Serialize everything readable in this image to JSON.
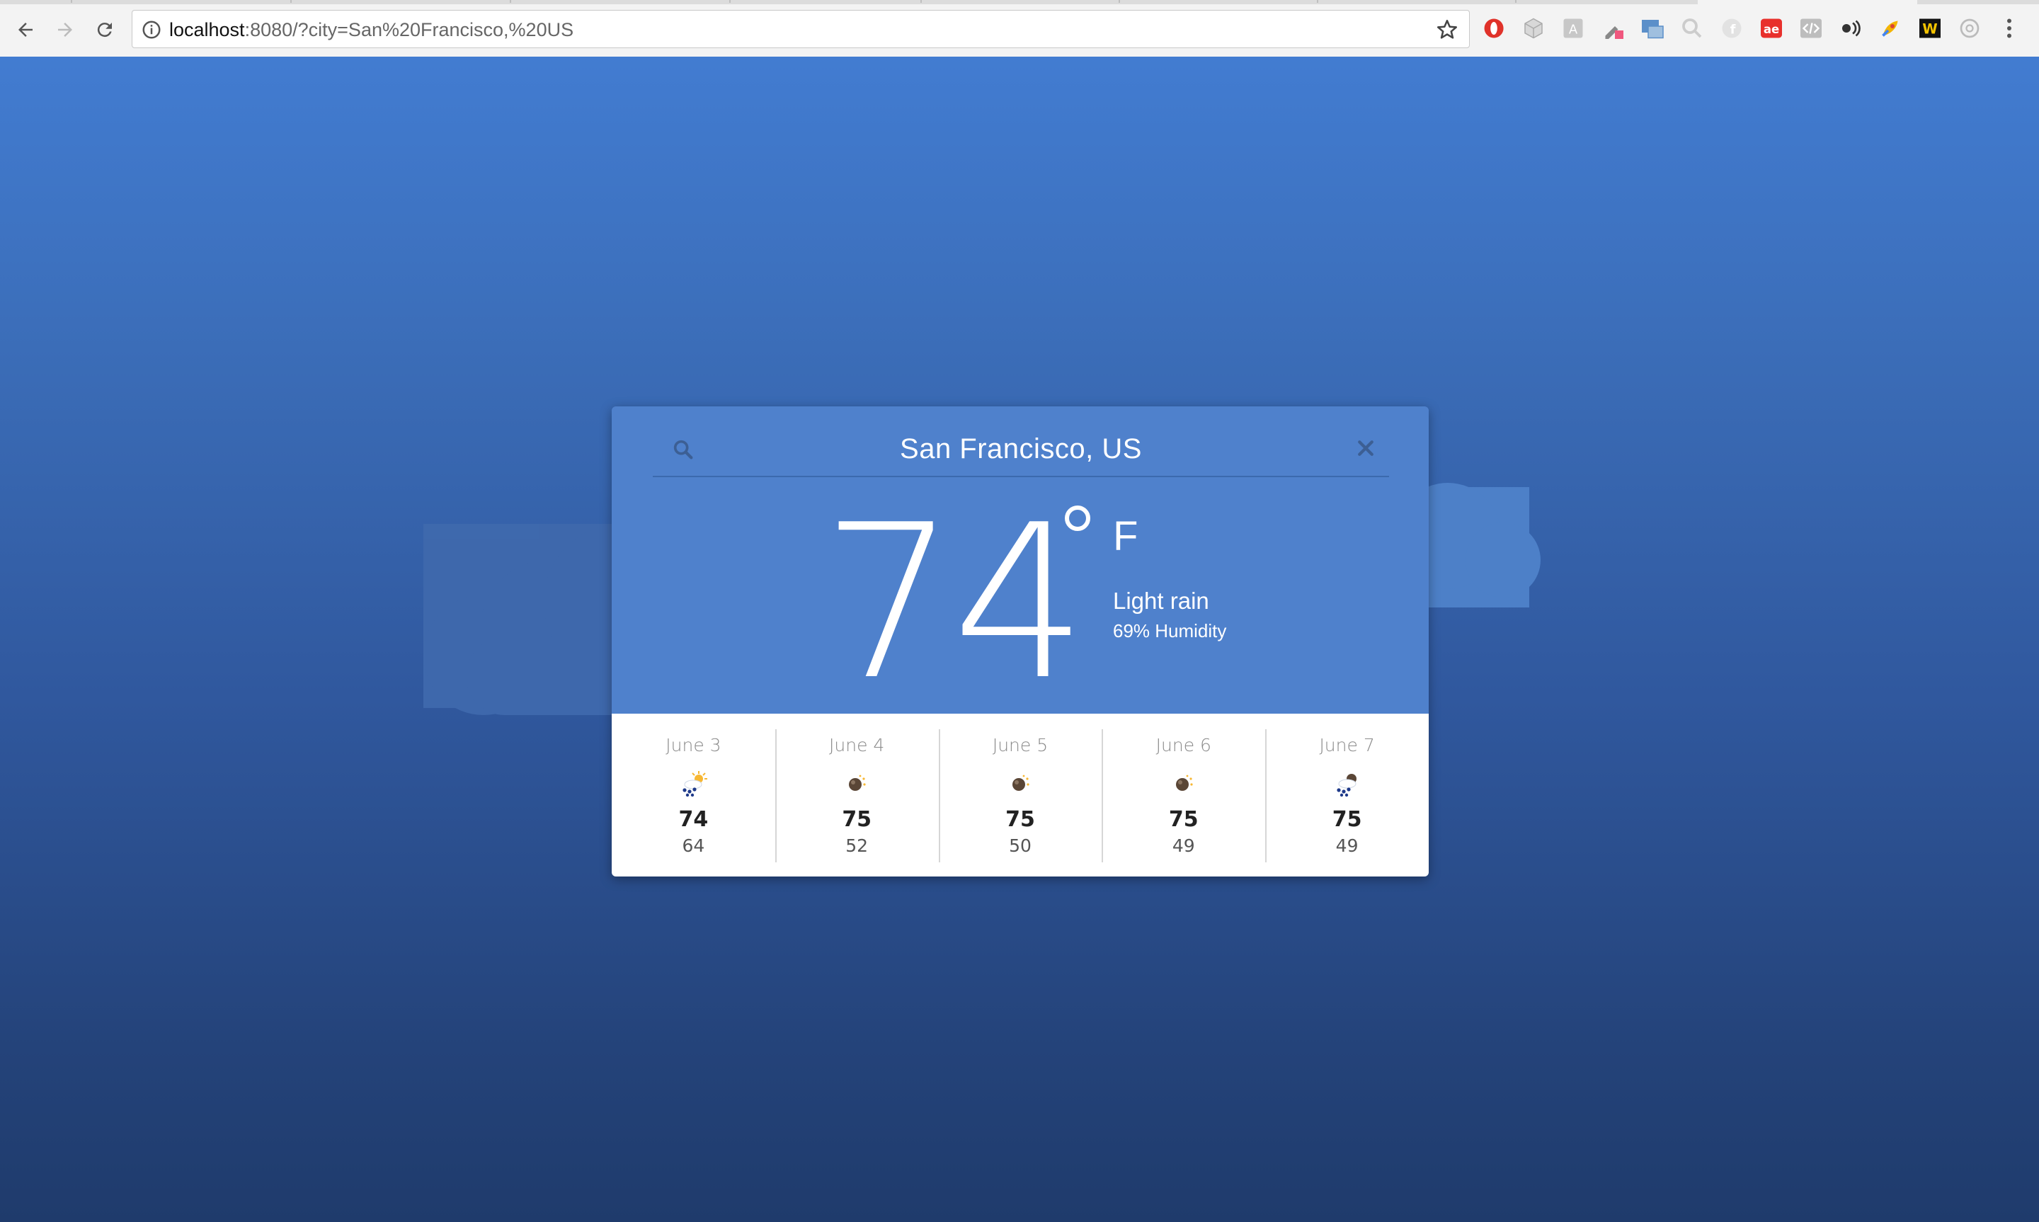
{
  "browser": {
    "url_host": "localhost",
    "url_rest": ":8080/?city=San%20Francisco,%20US"
  },
  "extensions": [
    "opera-icon",
    "cube-icon",
    "translate-icon",
    "eyedropper-icon",
    "window-icon",
    "magnifier-icon",
    "facebook-icon",
    "ae-icon",
    "code-icon",
    "audio-icon",
    "rocket-icon",
    "w-logo-icon",
    "circle-icon"
  ],
  "extension_labels": {
    "ae": "ae",
    "w": "W"
  },
  "weather": {
    "city": "San Francisco, US",
    "temperature": "74",
    "unit": "F",
    "description": "Light rain",
    "humidity": "69% Humidity"
  },
  "forecast": [
    {
      "date": "June 3",
      "high": "74",
      "low": "64",
      "icon": "rain-cloud-sun-icon"
    },
    {
      "date": "June 4",
      "high": "75",
      "low": "52",
      "icon": "dark-sun-icon"
    },
    {
      "date": "June 5",
      "high": "75",
      "low": "50",
      "icon": "dark-sun-icon"
    },
    {
      "date": "June 6",
      "high": "75",
      "low": "49",
      "icon": "dark-sun-icon"
    },
    {
      "date": "June 7",
      "high": "75",
      "low": "49",
      "icon": "rain-cloud-icon"
    }
  ],
  "colors": {
    "card_top": "#4f81cc",
    "page_gradient_top": "#427cd1",
    "page_gradient_bottom": "#1f3b6c",
    "cloud": "#5583c8"
  }
}
